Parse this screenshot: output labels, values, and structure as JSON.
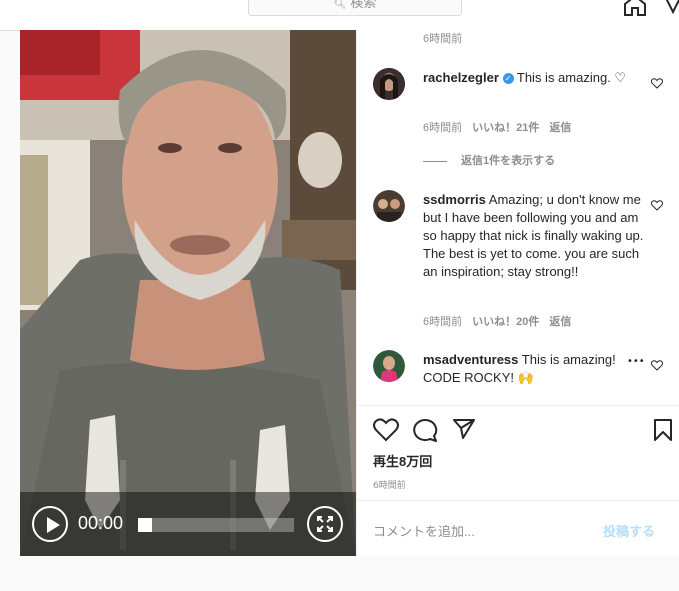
{
  "nav": {
    "search_placeholder": "検索"
  },
  "video": {
    "time": "00:00",
    "progress": 0
  },
  "comments": {
    "top_time": "6時間前",
    "items": [
      {
        "user": "rachelzegler",
        "verified": true,
        "text": "This is amazing. ♡",
        "time": "6時間前",
        "likes": "いいね！21件",
        "reply": "返信",
        "view_replies": "返信1件を表示する"
      },
      {
        "user": "ssdmorris",
        "text": "Amazing; u don't know me but I have been following you and am so happy that nick is finally waking up. The best is yet to come. you are such an inspiration; stay strong!!",
        "time": "6時間前",
        "likes": "いいね！20件",
        "reply": "返信"
      },
      {
        "user": "msadventuress",
        "text": "This is amazing! CODE ROCKY! 🙌",
        "more": "•••"
      }
    ]
  },
  "footer": {
    "views": "再生8万回",
    "posted": "6時間前",
    "add_comment_placeholder": "コメントを追加...",
    "post_button": "投稿する"
  },
  "colors": {
    "link_blue": "#0095f6",
    "post_disabled": "#b2dffc",
    "border": "#dbdbdb",
    "muted": "#8e8e8e"
  }
}
